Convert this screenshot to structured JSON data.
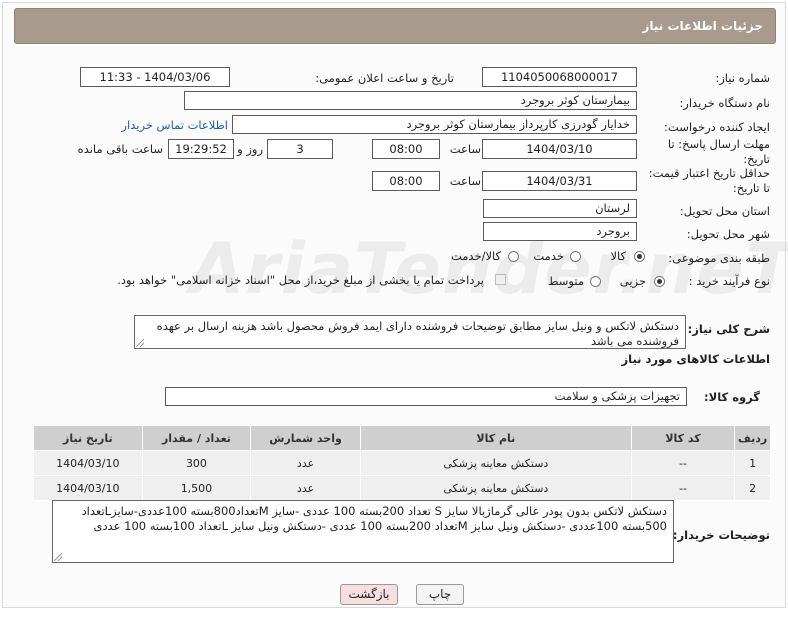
{
  "header": {
    "title": "جزئیات اطلاعات نیاز"
  },
  "form": {
    "need_number_label": "شماره نیاز:",
    "need_number": "1104050068000017",
    "announce_label": "تاریخ و ساعت اعلان عمومی:",
    "announce_value": "1404/03/06 - 11:33",
    "buyer_org_label": "نام دستگاه خریدار:",
    "buyer_org": "بیمارستان کوثر بروجرد",
    "creator_label": "ایجاد کننده درخواست:",
    "creator": "خدایار  گودرزی کارپرداز بیمارستان کوثر بروجرد",
    "contact_link": "اطلاعات تماس خریدار",
    "deadline_label_1": "مهلت ارسال پاسخ: تا",
    "deadline_label_2": "تاریخ:",
    "deadline_date": "1404/03/10",
    "time_label": "ساعت",
    "deadline_time": "08:00",
    "days_value": "3",
    "days_label": "روز و",
    "remaining_time": "19:29:52",
    "remaining_label": "ساعت باقی مانده",
    "validity_label_1": "حداقل تاریخ اعتبار قیمت:",
    "validity_label_2": "تا تاریخ:",
    "validity_date": "1404/03/31",
    "validity_time": "08:00",
    "province_label": "استان محل تحویل:",
    "province": "لرستان",
    "city_label": "شهر محل تحویل:",
    "city": "بروجرد",
    "category_label": "طبقه بندی موضوعی:",
    "category_options": [
      "کالا",
      "خدمت",
      "کالا/خدمت"
    ],
    "process_label": "نوع فرآیند خرید :",
    "process_options": [
      "جزیی",
      "متوسط"
    ],
    "payment_note": "پرداخت تمام یا بخشی از مبلغ خرید،از محل \"اسناد خزانه اسلامی\" خواهد بود.",
    "description_label": "شرح کلی نیاز:",
    "description": "دستکش لاتکس و ونیل سایز مطابق توضیحات فروشنده دارای ایمد فروش محصول باشد هزینه ارسال بر عهده فروشنده می باشد",
    "goods_info_title": "اطلاعات کالاهای مورد نیاز",
    "goods_group_label": "گروه کالا:",
    "goods_group": "تجهیزات پزشکی و سلامت"
  },
  "table": {
    "headers": [
      "ردیف",
      "کد کالا",
      "نام کالا",
      "واحد شمارش",
      "تعداد / مقدار",
      "تاریخ نیاز"
    ],
    "rows": [
      [
        "1",
        "--",
        "دستکش معاینه پزشکی",
        "عدد",
        "300",
        "1404/03/10"
      ],
      [
        "2",
        "--",
        "دستکش معاینه پزشکی",
        "عدد",
        "1,500",
        "1404/03/10"
      ]
    ]
  },
  "buyer_notes_label": "توضیحات خریدار:",
  "buyer_notes": "دستکش لاتکس بدون پودر عالی گرماژبالا سایز S تعداد 200بسته 100 عددی -سایز Mتعداد800بسته 100عددی-سایزLتعداد 500بسته 100عددی -دستکش ونیل سایز Mتعداد 200بسته 100 عددی -دستکش ونیل سایز Lتعداد 100بسته 100 عددی",
  "buttons": {
    "print": "چاپ",
    "back": "بازگشت"
  },
  "watermark": "AriaTender.neT"
}
